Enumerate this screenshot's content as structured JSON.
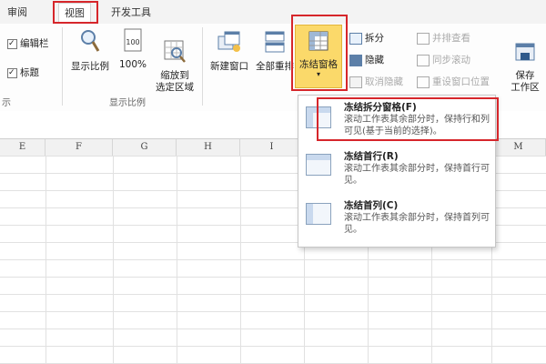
{
  "tabs": [
    {
      "label": "审阅"
    },
    {
      "label": "视图"
    },
    {
      "label": "开发工具"
    }
  ],
  "ribbon": {
    "checkboxes": [
      {
        "label": "编辑栏",
        "checked": true
      },
      {
        "label": "标题",
        "checked": true
      }
    ],
    "show_group_label": "示",
    "zoom_group": {
      "label": "显示比例",
      "buttons": [
        "显示比例",
        "100%",
        "缩放到\n选定区域"
      ]
    },
    "window_group": {
      "new_window": "新建窗口",
      "arrange_all": "全部重排",
      "freeze_panes": "冻结窗格",
      "split": "拆分",
      "hide": "隐藏",
      "unhide": "取消隐藏",
      "view_side_by_side": "并排查看",
      "sync_scroll": "同步滚动",
      "reset_position": "重设窗口位置",
      "save_workspace": "保存\n工作区"
    }
  },
  "columns": [
    "E",
    "F",
    "G",
    "H",
    "I",
    "J",
    "",
    "",
    "M"
  ],
  "dropdown": {
    "items": [
      {
        "title": "冻结拆分窗格(F)",
        "desc": "滚动工作表其余部分时，保持行和列可见(基于当前的选择)。"
      },
      {
        "title": "冻结首行(R)",
        "desc": "滚动工作表其余部分时，保持首行可见。"
      },
      {
        "title": "冻结首列(C)",
        "desc": "滚动工作表其余部分时，保持首列可见。"
      }
    ]
  },
  "colors": {
    "highlight": "#d6262b",
    "active_button": "#fbd96a"
  }
}
